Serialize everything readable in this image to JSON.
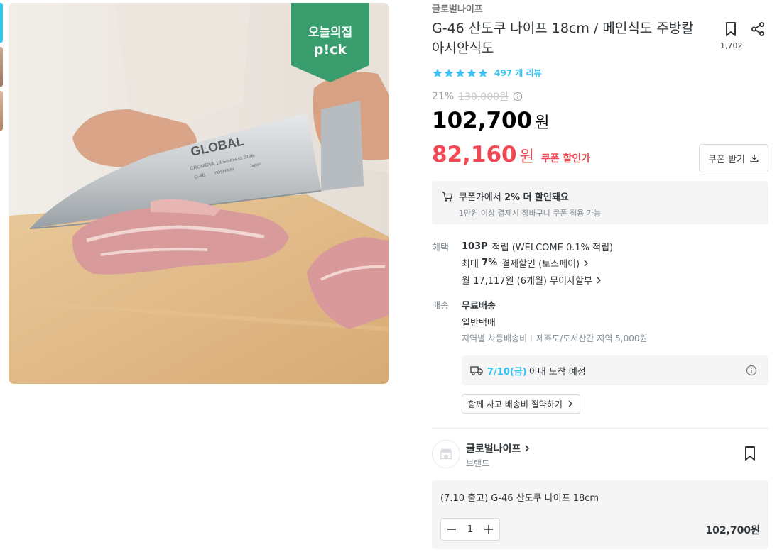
{
  "product": {
    "brand": "글로벌나이프",
    "title": "G-46 산도쿠 나이프 18cm / 메인식도 주방칼 아시안식도",
    "scrap_count": "1,702",
    "review_count": "497 개 리뷰",
    "rating_stars": 5,
    "discount_rate": "21%",
    "original_price": "130,000원",
    "sale_price": "102,700",
    "sale_unit": "원",
    "coupon_price": "82,160",
    "coupon_unit": "원",
    "coupon_tag": "쿠폰 할인가",
    "coupon_button": "쿠폰 받기",
    "image_badge_line1": "오늘의집",
    "image_badge_line2": "p!ck",
    "image_knife_brand": "GLOBAL",
    "image_knife_model": "G-46",
    "image_knife_line": "CROMOVA 18 Stainless Steel",
    "image_knife_maker": "YOSHIKIN",
    "image_knife_origin": "Japan"
  },
  "coupon_info": {
    "prefix": "쿠폰가에서",
    "highlight": "2% 더 할인돼요",
    "note": "1만원 이상 결제시 장바구니 쿠폰 적용 가능"
  },
  "benefit": {
    "label": "혜택",
    "points_bold": "103P",
    "points_text": "적립 (WELCOME 0.1% 적립)",
    "max_prefix": "최대",
    "max_bold": "7%",
    "max_text": "결제할인 (토스페이)",
    "installment": "월 17,117원 (6개월) 무이자할부"
  },
  "shipping": {
    "label": "배송",
    "type": "무료배송",
    "method": "일반택배",
    "extra1": "지역별 차등배송비",
    "extra2": "제주도/도서산간 지역 5,000원",
    "arrival_date": "7/10(금)",
    "arrival_text": "이내 도착 예정",
    "bundle_button": "함께 사고 배송비 절약하기"
  },
  "seller": {
    "name": "글로벌나이프",
    "sub": "브랜드"
  },
  "option": {
    "name": "(7.10 출고) G-46 산도쿠 나이프 18cm",
    "quantity": "1",
    "price": "102,700원"
  },
  "colors": {
    "accent": "#35c5f0",
    "sale_red": "#f24853",
    "badge_green": "#3a9d6d"
  }
}
